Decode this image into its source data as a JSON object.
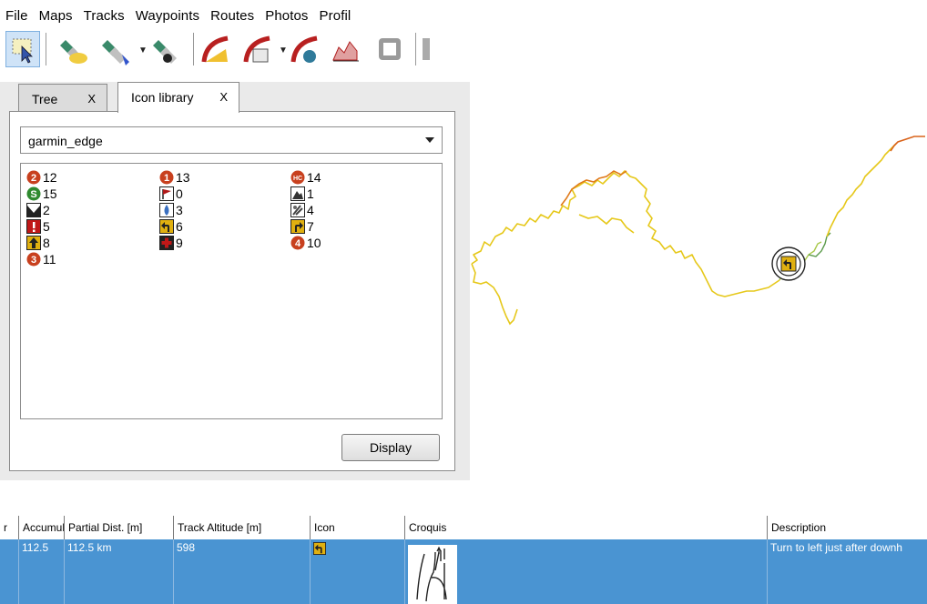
{
  "menu": [
    "File",
    "Maps",
    "Tracks",
    "Waypoints",
    "Routes",
    "Photos",
    "Profil"
  ],
  "toolbar": {
    "icons": [
      "select-icon",
      "waypoint-satellite-icon",
      "satellite-icon",
      "satellite-route-icon",
      "track-icon",
      "track-edit-icon",
      "track-globe-icon",
      "profile-chart-icon",
      "stop-icon"
    ]
  },
  "tabs": [
    {
      "label": "Tree",
      "close": "X"
    },
    {
      "label": "Icon library",
      "close": "X"
    }
  ],
  "dropdown": {
    "value": "garmin_edge"
  },
  "icons": [
    {
      "label": "12",
      "icon": "number-2-icon",
      "color": "#c8401e"
    },
    {
      "label": "13",
      "icon": "number-1-icon",
      "color": "#c8401e"
    },
    {
      "label": "14",
      "icon": "nc-icon",
      "color": "#c8401e"
    },
    {
      "label": "15",
      "icon": "s-icon",
      "color": "#2f8a2f"
    },
    {
      "label": "0",
      "icon": "red-flag-icon",
      "color": "#b01818"
    },
    {
      "label": "1",
      "icon": "summit-icon",
      "color": "#333333"
    },
    {
      "label": "2",
      "icon": "valley-icon",
      "color": "#333333"
    },
    {
      "label": "3",
      "icon": "water-drop-icon",
      "color": "#3a6fc0"
    },
    {
      "label": "4",
      "icon": "food-icon",
      "color": "#555555"
    },
    {
      "label": "5",
      "icon": "danger-icon",
      "color": "#c01818"
    },
    {
      "label": "6",
      "icon": "turn-left-icon",
      "color": "#e0b010"
    },
    {
      "label": "7",
      "icon": "turn-right-icon",
      "color": "#e0b010"
    },
    {
      "label": "8",
      "icon": "straight-icon",
      "color": "#e0b010"
    },
    {
      "label": "9",
      "icon": "first-aid-icon",
      "color": "#c01818"
    },
    {
      "label": "10",
      "icon": "number-4-icon",
      "color": "#c8401e"
    },
    {
      "label": "11",
      "icon": "number-3-icon",
      "color": "#c8401e"
    }
  ],
  "display_button": "Display",
  "table": {
    "columns": [
      "r",
      "Accumula",
      "Partial Dist. [m]",
      "Track Altitude [m]",
      "Icon",
      "Croquis",
      "Description"
    ],
    "row": {
      "accumulated": "112.5",
      "partial_dist": "112.5 km",
      "altitude": "598",
      "icon": "turn-left-icon",
      "croquis": "sketch-image",
      "description": "Turn to left just after downh"
    },
    "row_color": "#4a94d2"
  },
  "map": {
    "marker_icon": "turn-left-icon"
  }
}
